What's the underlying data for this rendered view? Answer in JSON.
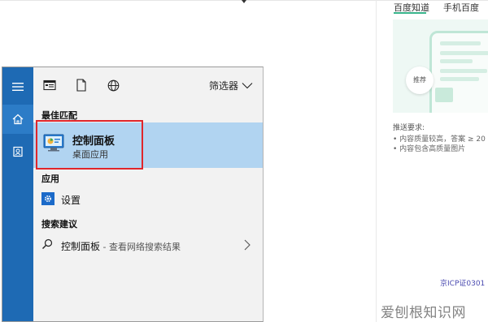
{
  "background": {
    "tabs": [
      "百度知道",
      "手机百度"
    ],
    "card_badge": "推荐",
    "requirements_title": "推送要求:",
    "requirements": [
      "• 内容质量较高，答案 ≥ 20",
      "• 内容包含高质量图片"
    ],
    "icp": "京ICP证0301"
  },
  "start_menu": {
    "filter_label": "筛选器",
    "sections": {
      "best_match": "最佳匹配",
      "apps": "应用",
      "suggestions": "搜索建议"
    },
    "best_match_item": {
      "title": "控制面板",
      "subtitle": "桌面应用"
    },
    "app_item": {
      "label": "设置"
    },
    "suggestion_item": {
      "label": "控制面板",
      "suffix": " - 查看网络搜索结果"
    },
    "colors": {
      "sidebar": "#1e6ab4",
      "highlight": "#b1d4f1",
      "red_box": "#e0262b"
    },
    "icons": [
      "menu-icon",
      "home-icon",
      "document-icon",
      "apps-icon",
      "file-icon",
      "globe-icon",
      "chevron-down-icon",
      "control-panel-icon",
      "gear-icon",
      "search-icon",
      "chevron-right-icon"
    ]
  },
  "watermark": "爱刨根知识网"
}
